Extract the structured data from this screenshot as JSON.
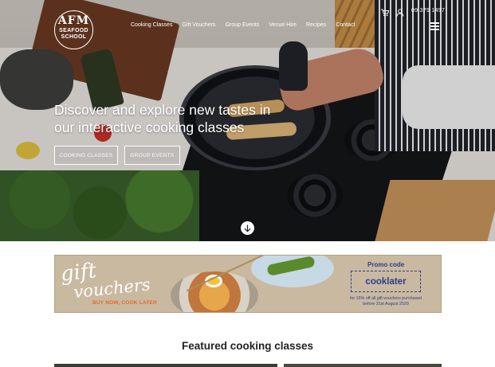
{
  "header": {
    "logo": {
      "line1": "AFM",
      "line2": "SEAFOOD",
      "line3": "SCHOOL"
    },
    "nav": [
      "Cooking Classes",
      "Gift Vouchers",
      "Group Events",
      "Venue Hire",
      "Recipes",
      "Contact"
    ],
    "phone": "09 379 1497",
    "icons": {
      "cart": "cart-icon",
      "account": "user-icon",
      "menu": "hamburger-menu-icon"
    }
  },
  "hero": {
    "headline_line1": "Discover and explore new tastes in",
    "headline_line2": "our interactive cooking classes",
    "buttons": [
      "COOKING CLASSES",
      "GROUP EVENTS"
    ],
    "scroll_icon": "arrow-down-icon"
  },
  "banner": {
    "gift": "gift",
    "vouchers": "vouchers",
    "tagline": "BUY NOW, COOK LATER",
    "promo_label": "Promo code",
    "promo_code": "cooklater",
    "fine_print_line1": "for 15% off all gift vouchers purchased",
    "fine_print_line2": "before 31st August 2020"
  },
  "featured": {
    "title": "Featured cooking classes"
  },
  "colors": {
    "promo_blue": "#2c3d8f",
    "tagline_orange": "#e7692a",
    "banner_bg": "#c9b9a0"
  }
}
